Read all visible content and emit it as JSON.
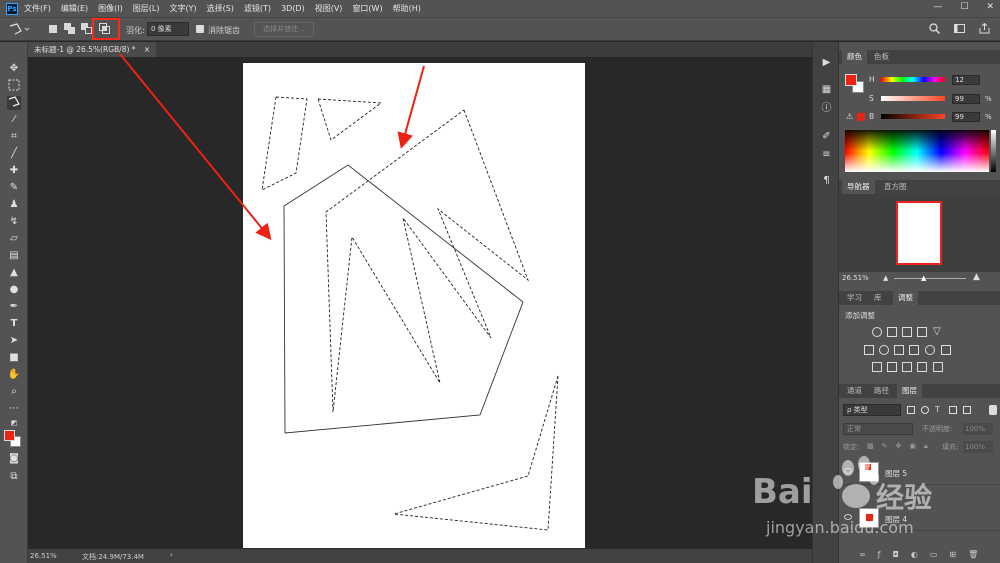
{
  "menubar": {
    "logo": "Ps",
    "items": [
      "文件(F)",
      "编辑(E)",
      "图像(I)",
      "图层(L)",
      "文字(Y)",
      "选择(S)",
      "滤镜(T)",
      "3D(D)",
      "视图(V)",
      "窗口(W)",
      "帮助(H)"
    ],
    "minimize": "—",
    "maximize": "☐",
    "close": "✕"
  },
  "options": {
    "feather_label": "羽化:",
    "feather_value": "0 像素",
    "antialias_label": "消除锯齿",
    "select_mask_label": "选择并遮住..."
  },
  "document": {
    "tab_title": "未标题-1 @ 26.5%(RGB/8) *",
    "tab_close": "×"
  },
  "status": {
    "zoom": "26.51%",
    "doc_info": "文档:24.9M/73.4M",
    "arrow": "›"
  },
  "color_panel": {
    "tabs": [
      "颜色",
      "色板"
    ],
    "channels": [
      {
        "label": "H",
        "value": "12",
        "unit": ""
      },
      {
        "label": "S",
        "value": "99",
        "unit": "%"
      },
      {
        "label": "B",
        "value": "99",
        "unit": "%"
      }
    ]
  },
  "navigator_panel": {
    "tabs": [
      "导航器",
      "直方图"
    ],
    "zoom": "26.51%"
  },
  "adjust_panel": {
    "tabs": [
      "学习",
      "库",
      "调整"
    ],
    "title": "添加调整"
  },
  "layers_panel": {
    "tabs": [
      "通道",
      "路径",
      "图层"
    ],
    "filter_label": "ρ 类型",
    "blend_mode": "正常",
    "opacity_label": "不透明度:",
    "opacity_value": "100%",
    "lock_label": "锁定:",
    "fill_label": "填充:",
    "fill_value": "100%",
    "layers": [
      {
        "name": "图层 5"
      },
      {
        "name": "图层 4"
      }
    ]
  },
  "watermark": {
    "brand": "Bai",
    "brand_cn": "经验",
    "url": "jingyan.baidu.com"
  },
  "colors": {
    "foreground": "#ee2211",
    "background": "#ffffff",
    "annotation": "#ee2211"
  }
}
